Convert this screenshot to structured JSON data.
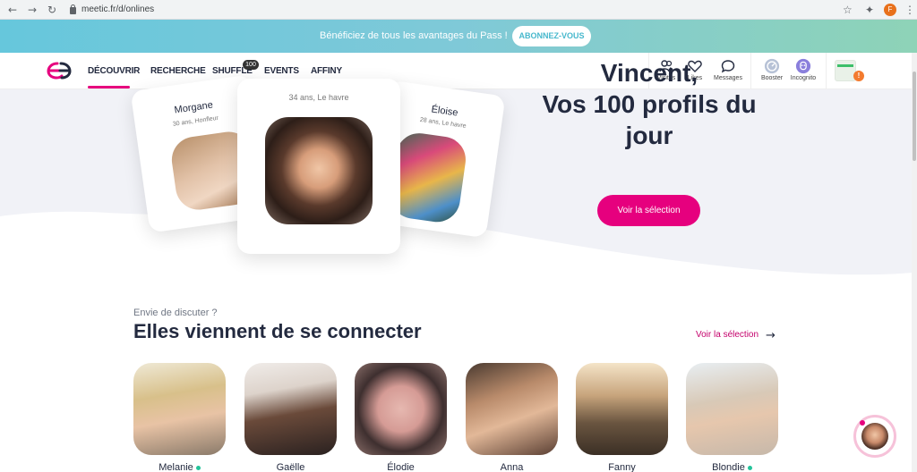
{
  "browser": {
    "url": "meetic.fr/d/onlines",
    "profile_initial": "F"
  },
  "promo": {
    "text": "Bénéficiez de tous les avantages du Pass !",
    "button": "ABONNEZ-VOUS"
  },
  "nav": {
    "items": [
      "DÉCOUVRIR",
      "RECHERCHE",
      "SHUFFLE",
      "EVENTS",
      "AFFINY"
    ],
    "shuffle_badge": "100",
    "tools": [
      "Visites",
      "Likes",
      "Messages",
      "Booster",
      "Incognito"
    ],
    "alert": "!"
  },
  "hero": {
    "cards": [
      {
        "name": "Morgane",
        "sub": "30 ans, Honfleur"
      },
      {
        "name": "",
        "sub": "34 ans, Le havre"
      },
      {
        "name": "Éloise",
        "sub": "28 ans, Le havre"
      }
    ],
    "title_line1": "Vincent,",
    "title_line2": "Vos 100 profils du",
    "title_line3": "jour",
    "button": "Voir la sélection"
  },
  "section": {
    "kicker": "Envie de discuter ?",
    "title": "Elles viennent de se connecter",
    "link": "Voir la sélection",
    "profiles": [
      {
        "name": "Melanie",
        "online": true
      },
      {
        "name": "Gaëlle",
        "online": false
      },
      {
        "name": "Élodie",
        "online": false
      },
      {
        "name": "Anna",
        "online": false
      },
      {
        "name": "Fanny",
        "online": false
      },
      {
        "name": "Blondie",
        "online": true
      }
    ]
  },
  "colors": {
    "brand_pink": "#e6007e",
    "dark_text": "#232a3f",
    "online_green": "#23c39a"
  }
}
